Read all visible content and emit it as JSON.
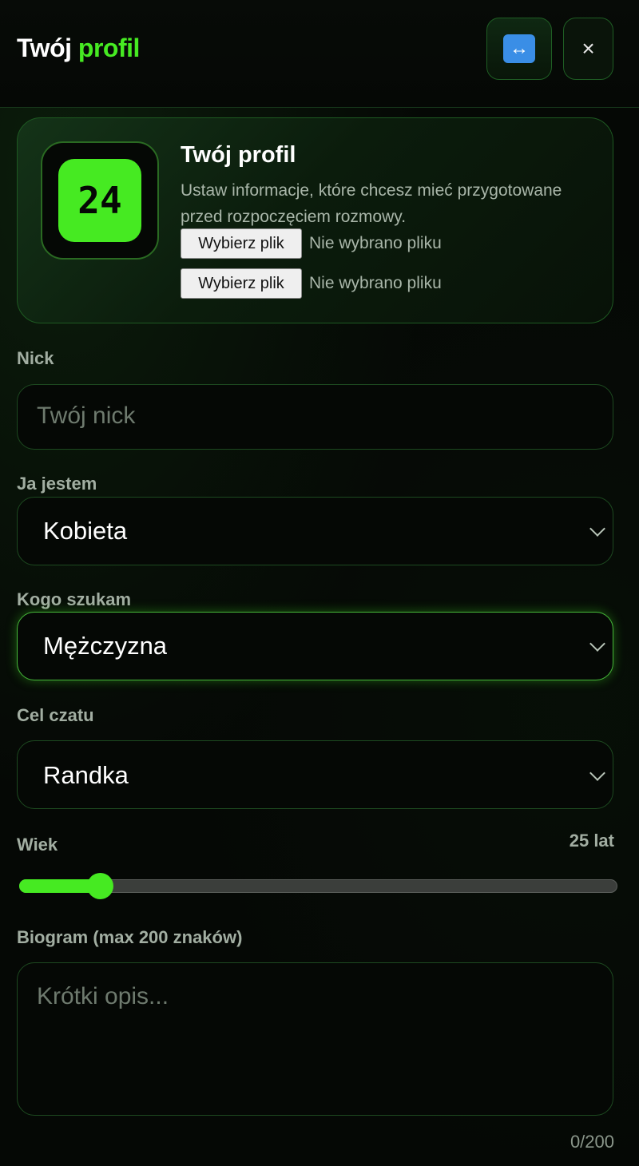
{
  "header": {
    "title_part1": "Twój",
    "title_part2": "profil",
    "resize_icon": "↔",
    "close_icon": "×"
  },
  "profile_card": {
    "avatar_text": "24",
    "title": "Twój profil",
    "description": "Ustaw informacje, które chcesz mieć przygotowane przed rozpoczęciem rozmowy.",
    "file_inputs": [
      {
        "button_label": "Wybierz plik",
        "status": "Nie wybrano pliku"
      },
      {
        "button_label": "Wybierz plik",
        "status": "Nie wybrano pliku"
      }
    ]
  },
  "form": {
    "nick": {
      "label": "Nick",
      "placeholder": "Twój nick",
      "value": ""
    },
    "i_am": {
      "label": "Ja jestem",
      "value": "Kobieta"
    },
    "looking_for": {
      "label": "Kogo szukam",
      "value": "Mężczyzna"
    },
    "chat_goal": {
      "label": "Cel czatu",
      "value": "Randka"
    },
    "age": {
      "label": "Wiek",
      "value_text": "25 lat",
      "value": 25,
      "fraction": 0.135
    },
    "bio": {
      "label": "Biogram (max 200 znaków)",
      "placeholder": "Krótki opis...",
      "counter": "0/200"
    }
  },
  "colors": {
    "accent": "#46ea22",
    "background": "#050805",
    "border": "#1d4a20"
  }
}
